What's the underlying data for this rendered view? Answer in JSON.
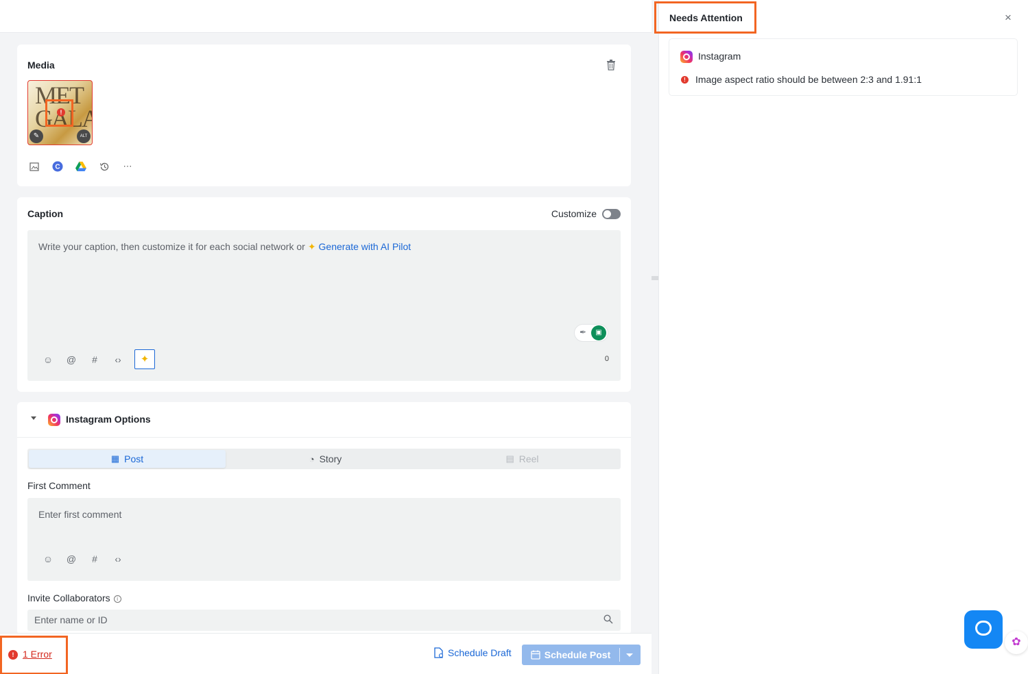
{
  "media": {
    "title": "Media",
    "thumb_text": "MET GALA",
    "alt_badge": "ALT"
  },
  "caption": {
    "title": "Caption",
    "customize_label": "Customize",
    "placeholder": "Write your caption, then customize it for each social network or",
    "ai_link": "Generate with AI Pilot",
    "char_count": "0"
  },
  "instagram": {
    "title": "Instagram Options",
    "tabs": [
      {
        "label": "Post",
        "state": "active"
      },
      {
        "label": "Story",
        "state": "normal"
      },
      {
        "label": "Reel",
        "state": "disabled"
      }
    ],
    "first_comment_label": "First Comment",
    "first_comment_placeholder": "Enter first comment",
    "collab_label": "Invite Collaborators",
    "collab_placeholder": "Enter name or ID"
  },
  "footer": {
    "error_text": "1 Error",
    "schedule_draft": "Schedule Draft",
    "schedule_post": "Schedule Post"
  },
  "panel": {
    "title": "Needs Attention",
    "network": "Instagram",
    "message": "Image aspect ratio should be between 2:3 and 1.91:1"
  },
  "colors": {
    "accent": "#1a67d6",
    "error": "#e23a2e",
    "highlight": "#f26522",
    "primary_button": "#93b9ec"
  }
}
